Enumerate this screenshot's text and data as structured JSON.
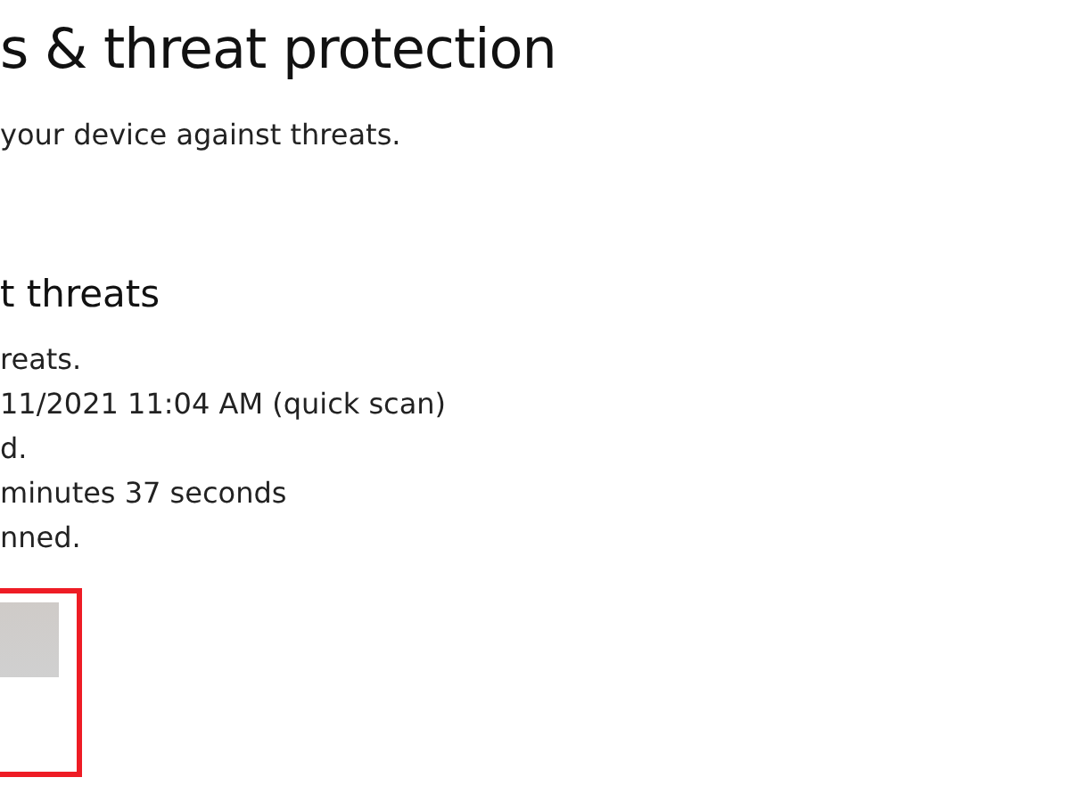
{
  "page": {
    "title": "s & threat protection",
    "subtitle": "your device against threats."
  },
  "section": {
    "heading": "t threats",
    "lines": [
      "reats.",
      "11/2021 11:04 AM (quick scan)",
      "d.",
      "minutes 37 seconds",
      "nned."
    ]
  },
  "highlight": {
    "color": "#ee1c25"
  }
}
